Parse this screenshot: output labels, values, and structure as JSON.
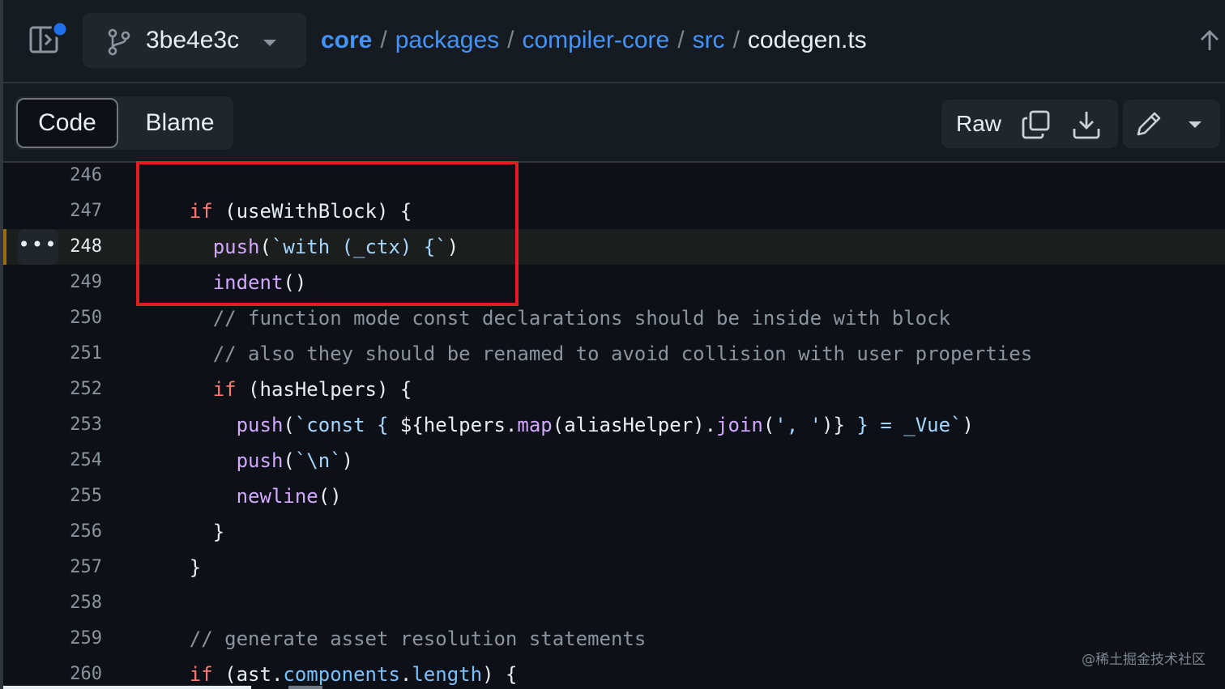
{
  "header": {
    "branch": "3be4e3c",
    "breadcrumb": {
      "items": [
        "core",
        "packages",
        "compiler-core",
        "src"
      ],
      "separator": "/",
      "current": "codegen.ts"
    }
  },
  "toolbar": {
    "tab_code": "Code",
    "tab_blame": "Blame",
    "raw_label": "Raw"
  },
  "code": {
    "highlighted_line": 248,
    "lines": [
      {
        "n": "246",
        "tokens": []
      },
      {
        "n": "247",
        "tokens": [
          {
            "t": "    "
          },
          {
            "t": "if",
            "c": "kw"
          },
          {
            "t": " (useWithBlock) {"
          }
        ]
      },
      {
        "n": "248",
        "tokens": [
          {
            "t": "      "
          },
          {
            "t": "push",
            "c": "fn"
          },
          {
            "t": "("
          },
          {
            "t": "`with (_ctx) {`",
            "c": "str"
          },
          {
            "t": ")"
          }
        ]
      },
      {
        "n": "249",
        "tokens": [
          {
            "t": "      "
          },
          {
            "t": "indent",
            "c": "fn"
          },
          {
            "t": "()"
          }
        ]
      },
      {
        "n": "250",
        "tokens": [
          {
            "t": "      "
          },
          {
            "t": "// function mode const declarations should be inside with block",
            "c": "cm"
          }
        ]
      },
      {
        "n": "251",
        "tokens": [
          {
            "t": "      "
          },
          {
            "t": "// also they should be renamed to avoid collision with user properties",
            "c": "cm"
          }
        ]
      },
      {
        "n": "252",
        "tokens": [
          {
            "t": "      "
          },
          {
            "t": "if",
            "c": "kw"
          },
          {
            "t": " (hasHelpers) {"
          }
        ]
      },
      {
        "n": "253",
        "tokens": [
          {
            "t": "        "
          },
          {
            "t": "push",
            "c": "fn"
          },
          {
            "t": "("
          },
          {
            "t": "`const { ",
            "c": "str"
          },
          {
            "t": "${helpers."
          },
          {
            "t": "map",
            "c": "fn"
          },
          {
            "t": "(aliasHelper)."
          },
          {
            "t": "join",
            "c": "fn"
          },
          {
            "t": "("
          },
          {
            "t": "', '",
            "c": "str"
          },
          {
            "t": ")}"
          },
          {
            "t": " } = _Vue`",
            "c": "str"
          },
          {
            "t": ")"
          }
        ]
      },
      {
        "n": "254",
        "tokens": [
          {
            "t": "        "
          },
          {
            "t": "push",
            "c": "fn"
          },
          {
            "t": "("
          },
          {
            "t": "`\\n`",
            "c": "str"
          },
          {
            "t": ")"
          }
        ]
      },
      {
        "n": "255",
        "tokens": [
          {
            "t": "        "
          },
          {
            "t": "newline",
            "c": "fn"
          },
          {
            "t": "()"
          }
        ]
      },
      {
        "n": "256",
        "tokens": [
          {
            "t": "      }"
          }
        ]
      },
      {
        "n": "257",
        "tokens": [
          {
            "t": "    }"
          }
        ]
      },
      {
        "n": "258",
        "tokens": []
      },
      {
        "n": "259",
        "tokens": [
          {
            "t": "    "
          },
          {
            "t": "// generate asset resolution statements",
            "c": "cm"
          }
        ]
      },
      {
        "n": "260",
        "tokens": [
          {
            "t": "    "
          },
          {
            "t": "if",
            "c": "kw"
          },
          {
            "t": " (ast."
          },
          {
            "t": "components",
            "c": "prop"
          },
          {
            "t": "."
          },
          {
            "t": "length",
            "c": "prop"
          },
          {
            "t": ") {"
          }
        ]
      }
    ]
  },
  "more_button": "•••",
  "watermark": "@稀土掘金技术社区",
  "colors": {
    "link": "#4493f8",
    "keyword": "#ff7b72",
    "function": "#d2a8ff",
    "string": "#a5d6ff",
    "comment": "#8b949e",
    "annotation_box": "#e51b23"
  },
  "icons": {
    "panel_toggle": "sidebar-expand-icon",
    "branch": "git-branch-icon",
    "copy": "copy-icon",
    "download": "download-icon",
    "edit": "pencil-icon",
    "up": "arrow-up-icon"
  }
}
